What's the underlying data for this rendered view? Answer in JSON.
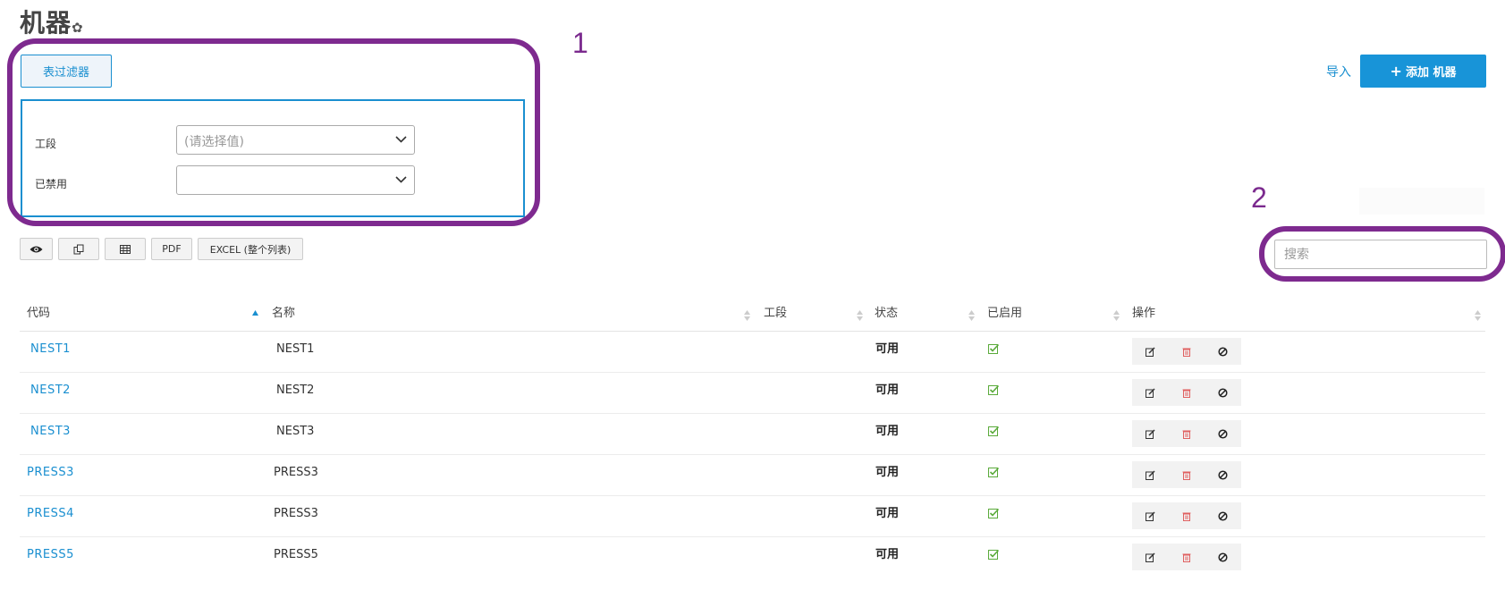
{
  "page": {
    "title": "机器",
    "gear_glyph": "✿"
  },
  "annotations": [
    "1",
    "2"
  ],
  "filter": {
    "toggle_label": "表过滤器",
    "fields": [
      {
        "label": "工段",
        "placeholder": "(请选择值)"
      },
      {
        "label": "已禁用",
        "placeholder": ""
      }
    ]
  },
  "header_actions": {
    "import_label": "导入",
    "add_label": "添加 机器",
    "add_icon": "plus-icon"
  },
  "toolbar": {
    "buttons": [
      {
        "icon": "eye-icon"
      },
      {
        "icon": "copy-icon"
      },
      {
        "icon": "table-icon"
      },
      {
        "label": "PDF"
      },
      {
        "label": "EXCEL (整个列表)"
      }
    ]
  },
  "search": {
    "placeholder": "搜索"
  },
  "table": {
    "columns": [
      "代码",
      "名称",
      "工段",
      "状态",
      "已启用",
      "操作"
    ],
    "rows": [
      {
        "code": "NEST1",
        "name": "NEST1",
        "segment": "",
        "status": "可用",
        "enabled": true
      },
      {
        "code": "NEST2",
        "name": "NEST2",
        "segment": "",
        "status": "可用",
        "enabled": true
      },
      {
        "code": "NEST3",
        "name": "NEST3",
        "segment": "",
        "status": "可用",
        "enabled": true
      },
      {
        "code": "PRESS3",
        "name": "PRESS3",
        "segment": "",
        "status": "可用",
        "enabled": true
      },
      {
        "code": "PRESS4",
        "name": "PRESS3",
        "segment": "",
        "status": "可用",
        "enabled": true
      },
      {
        "code": "PRESS5",
        "name": "PRESS5",
        "segment": "",
        "status": "可用",
        "enabled": true
      }
    ],
    "row_actions": [
      "edit-icon",
      "delete-icon",
      "disable-icon"
    ]
  },
  "colors": {
    "accent": "#1894d8",
    "annotation": "#7e2a8f",
    "check": "#5aaa3a",
    "delete": "#e06060"
  }
}
